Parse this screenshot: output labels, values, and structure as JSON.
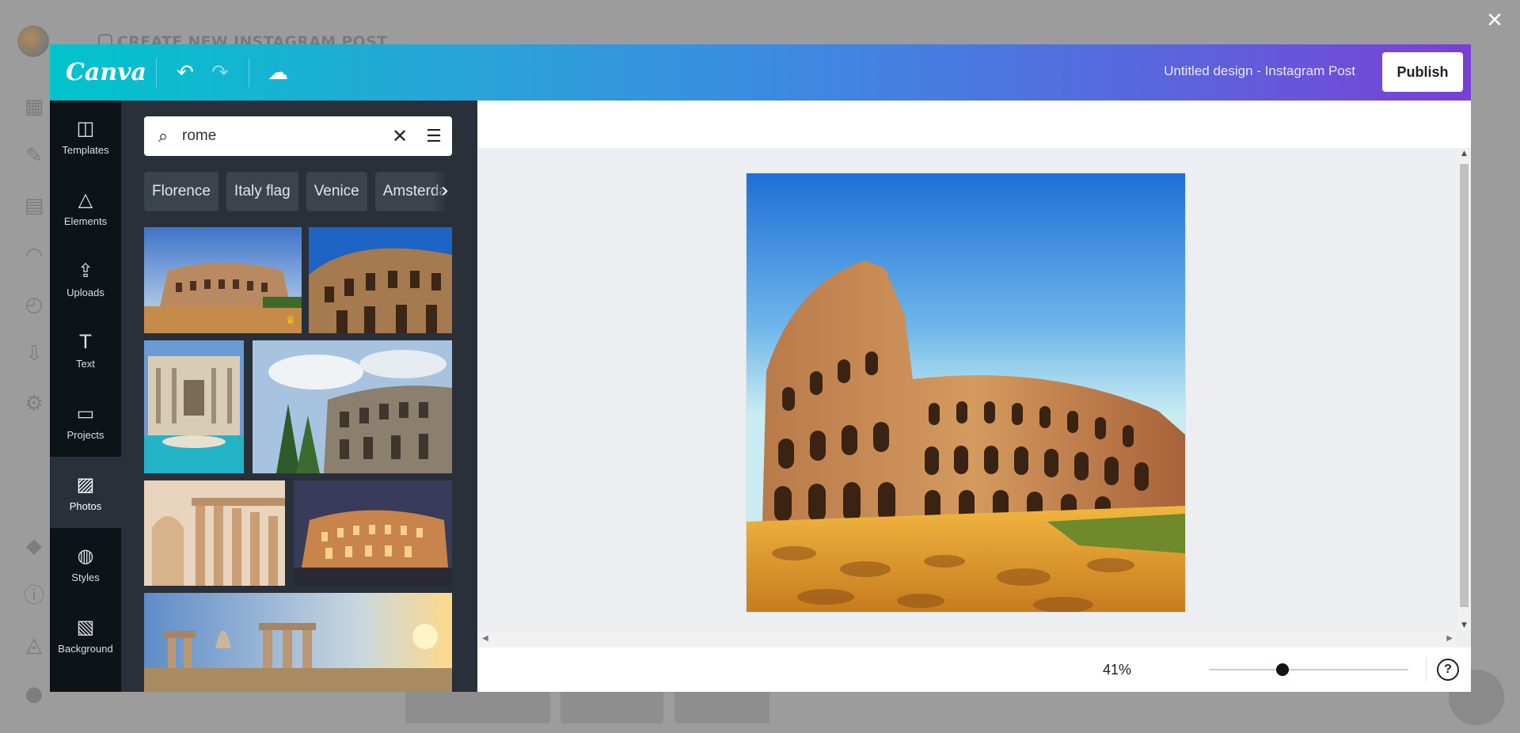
{
  "background": {
    "page_title": "CREATE NEW INSTAGRAM POST",
    "close_glyph": "✕"
  },
  "toolbar": {
    "logo": "Canva",
    "undo_icon": "↶",
    "redo_icon": "↷",
    "cloud_icon": "☁",
    "document_title": "Untitled design - Instagram Post",
    "publish_label": "Publish"
  },
  "sidebar": {
    "items": [
      {
        "label": "Templates",
        "icon": "template-icon",
        "glyph": "◫"
      },
      {
        "label": "Elements",
        "icon": "shapes-icon",
        "glyph": "△"
      },
      {
        "label": "Uploads",
        "icon": "cloud-upload-icon",
        "glyph": "⇪"
      },
      {
        "label": "Text",
        "icon": "text-icon",
        "glyph": "T"
      },
      {
        "label": "Projects",
        "icon": "folder-icon",
        "glyph": "▭"
      },
      {
        "label": "Photos",
        "icon": "image-icon",
        "glyph": "▨"
      },
      {
        "label": "Styles",
        "icon": "palette-icon",
        "glyph": "◍"
      },
      {
        "label": "Background",
        "icon": "hatch-icon",
        "glyph": "▧"
      }
    ],
    "active": "Photos"
  },
  "panel": {
    "search_value": "rome",
    "search_icon": "⌕",
    "clear_icon": "✕",
    "filter_icon": "☰",
    "chips": [
      "Florence",
      "Italy flag",
      "Venice",
      "Amsterdam"
    ],
    "chip_arrow": "›",
    "collapse_icon": "‹"
  },
  "canvas": {
    "zoom": "41%",
    "zoom_level": 0.41,
    "help_label": "?"
  },
  "colors": {
    "gradient_start": "#00c4cc",
    "gradient_end": "#7a3fd6",
    "sidebar_bg": "#0e1318",
    "panel_bg": "#293039"
  }
}
